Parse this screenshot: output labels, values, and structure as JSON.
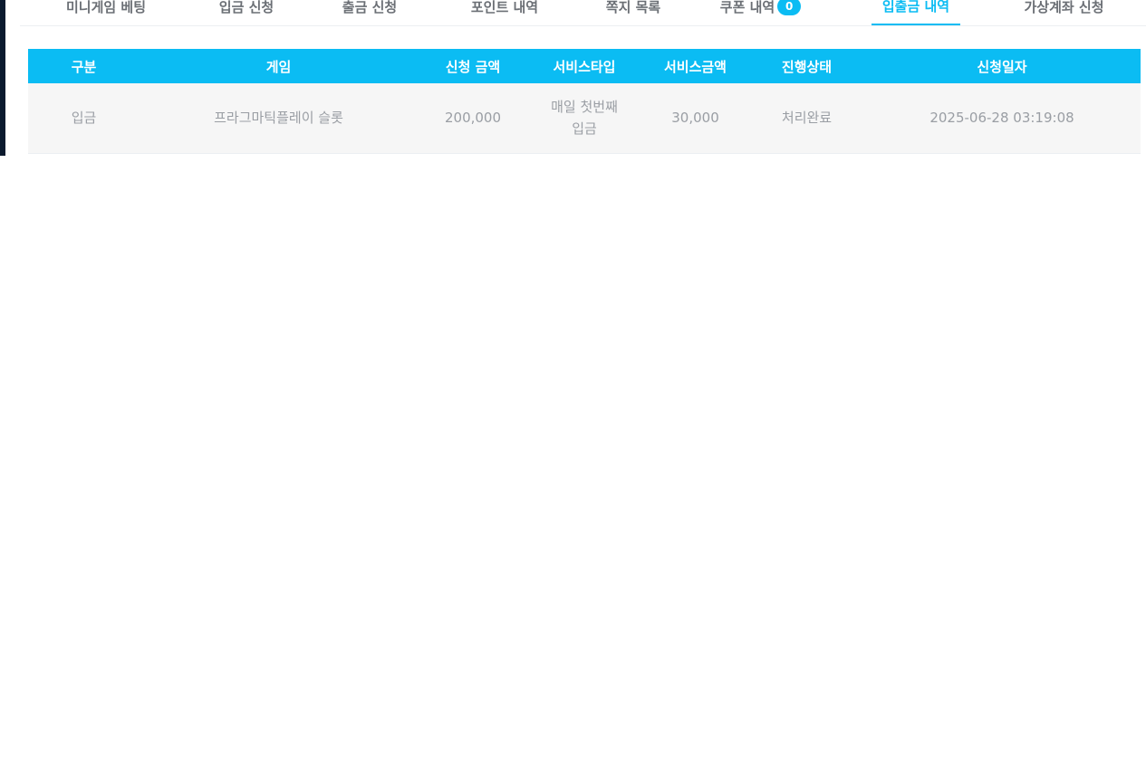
{
  "tabs": [
    {
      "label": "미니게임 베팅",
      "active": false
    },
    {
      "label": "입금 신청",
      "active": false
    },
    {
      "label": "출금 신청",
      "active": false
    },
    {
      "label": "포인트 내역",
      "active": false
    },
    {
      "label": "쪽지 목록",
      "active": false
    },
    {
      "label": "쿠폰 내역",
      "active": false,
      "badge": "0"
    },
    {
      "label": "입출금 내역",
      "active": true
    },
    {
      "label": "가상계좌 신청",
      "active": false
    }
  ],
  "table": {
    "headers": [
      "구분",
      "게임",
      "신청 금액",
      "서비스타입",
      "서비스금액",
      "진행상태",
      "신청일자"
    ],
    "rows": [
      {
        "type": "입금",
        "game": "프라그마틱플레이 슬롯",
        "amount": "200,000",
        "service_type": "매일 첫번째 입금",
        "service_amount": "30,000",
        "status": "처리완료",
        "date": "2025-06-28 03:19:08"
      }
    ]
  },
  "colors": {
    "accent": "#0bbcf3",
    "row_bg": "#f6f6f6",
    "text_muted": "#9a9ea4"
  }
}
